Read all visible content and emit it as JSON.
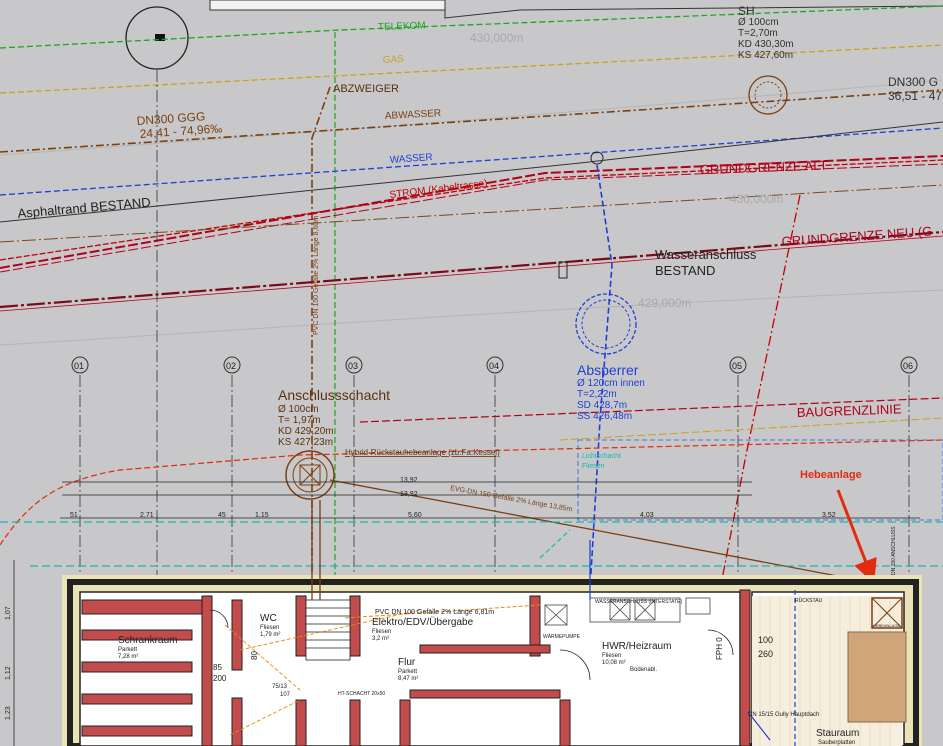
{
  "colors": {
    "background": "#c8c8ca",
    "telekom": "#1fa51f",
    "gas": "#c9a21b",
    "abwasser": "#7a3f10",
    "wasser": "#1f3fd6",
    "strom": "#c40000",
    "grundgrenze": "#b0001a",
    "cyan_line": "#18b8b0",
    "wall": "#222222",
    "wall_fill": "#e9e4b8",
    "arrow_red": "#e32b12"
  },
  "labels": {
    "sh_title": "SH",
    "sh_d": "Ø 100cm",
    "sh_t": "T=2,70m",
    "sh_kd": "KD 430,30m",
    "sh_ks": "KS 427,60m",
    "dn300_right": "DN300 G",
    "dn300_right_val": "36,51 - 47",
    "elev_430": "430,000m",
    "elev_430_b": "430,000m",
    "elev_429": "429,000m",
    "telekom": "TELEKOM",
    "gas": "GAS",
    "abzweiger": "ABZWEIGER",
    "abwasser": "ABWASSER",
    "wasser": "WASSER",
    "strom": "STROM (Kabeltrasse)",
    "dn300_left": "DN300 GGG",
    "dn300_left_val": "24,41 - 74,96‰",
    "asphalt": "Asphaltrand BESTAND",
    "grundgrenze_alt": "GRUNDGRENZE ALT",
    "grundgrenze_neu": "GRUNDGRENZE NEU (G",
    "wasseranschluss_1": "Wasseranschluss",
    "wasseranschluss_2": "BESTAND",
    "pvc_vertical": "PVC DN 150 Gefälle 2% Länge 8,60m",
    "axis_01": "01",
    "axis_02": "02",
    "axis_03": "03",
    "axis_04": "04",
    "axis_05": "05",
    "axis_06": "06",
    "absperrer_title": "Absperrer",
    "absperrer_d": "Ø 120cm innen",
    "absperrer_t": "T=2,22m",
    "absperrer_sd": "SD 428,7m",
    "absperrer_ss": "SS 426,48m",
    "baugrenzlinie": "BAUGRENZLINIE",
    "anschluss_title": "Anschlussschacht",
    "anschluss_d": "Ø 100cm",
    "anschluss_t": "T= 1,97m",
    "anschluss_kd": "KD 429,20m",
    "anschluss_ks": "KS 427,23m",
    "hybrid": "Hybrid-Rückstauhebeanlage (zb.Fa.Kessel)",
    "hebeanlage": "Hebeanlage",
    "dim_1392": "13,92",
    "dim_1392b": "13,92",
    "evg_dn": "EVG-DN 150 Gefälle 2% Länge 13,85m",
    "dim_51": "51",
    "dim_271": "2,71",
    "dim_45": "45",
    "dim_115": "1,15",
    "dim_560": "5,60",
    "dim_403": "4,03",
    "dim_352": "3,52",
    "wc_title": "WC",
    "wc_sub": "Fliesen",
    "wc_area": "1,79 m²",
    "elektro_title": "Elektro/EDV/Übergabe",
    "elektro_sub": "Fliesen",
    "elektro_area": "3,2 m²",
    "pvc_horizontal": "PVC DN 100 Gefälle 2% Länge 6,81m",
    "waermepumpe": "WÄRMEPUMPE",
    "wasseranschluss_box": "WASSERANSCHLUSS (INTERSTATE)",
    "hwr_title": "HWR/Heizraum",
    "hwr_sub": "Fliesen",
    "hwr_area": "10,08 m²",
    "bodenablauf": "Bodenabl.",
    "schrankraum_title": "Schrankraum",
    "schrankraum_sub": "Parkett",
    "schrankraum_area": "7,28 m²",
    "flur_title": "Flur",
    "flur_sub": "Parkett",
    "flur_area": "8,47 m²",
    "door_85": "85",
    "door_200": "200",
    "door_80": "80",
    "door_75": "75/13",
    "door_107": "107",
    "schacht": "HT-SCHACHT 20x50",
    "fph": "FPH 0",
    "win_100": "100",
    "win_260": "260",
    "stauraum_title": "Stauraum",
    "stauraum_sub": "Sauberplatten",
    "gully": "DN 15/15 Gully Hauptdach",
    "hebeanlage_box": "HEBEANLAGE",
    "rueckstau": "RÜCKSTAU",
    "dn_anschluss": "DN 150 ANSCHLUSS",
    "dim_left_1": "1,12",
    "dim_left_2": "1,07",
    "dim_left_3": "1,23",
    "fliesen_green": "Fliesen",
    "lichtschacht": "Lichtschacht"
  }
}
